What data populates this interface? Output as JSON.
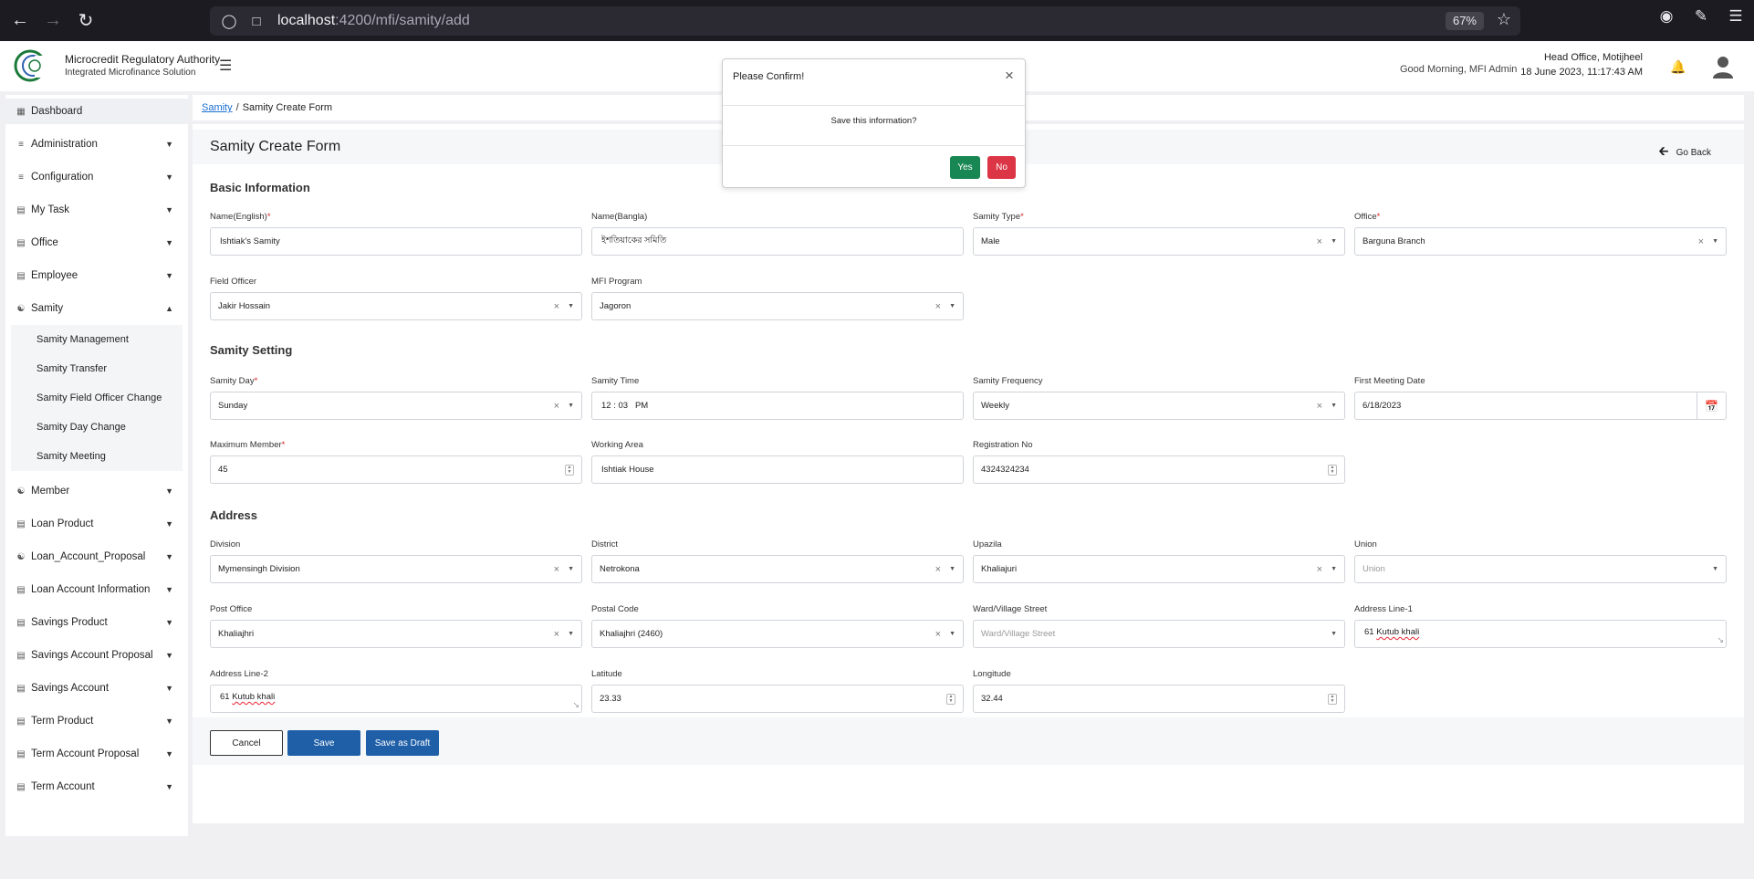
{
  "browser": {
    "url_host": "localhost",
    "url_path": ":4200/mfi/samity/add",
    "zoom": "67%"
  },
  "header": {
    "brand_title": "Microcredit Regulatory Authority",
    "brand_subtitle": "Integrated Microfinance Solution",
    "greeting": "Good Morning, MFI Admin",
    "office": "Head Office, Motijheel",
    "datetime": "18 June 2023, 11:17:43 AM"
  },
  "sidebar": {
    "dashboard": "Dashboard",
    "items": [
      {
        "label": "Administration",
        "icon": "sliders-icon"
      },
      {
        "label": "Configuration",
        "icon": "sliders-icon"
      },
      {
        "label": "My Task",
        "icon": "task-icon"
      },
      {
        "label": "Office",
        "icon": "office-icon"
      },
      {
        "label": "Employee",
        "icon": "employee-icon"
      },
      {
        "label": "Samity",
        "icon": "group-icon"
      }
    ],
    "samity_sub": [
      "Samity Management",
      "Samity Transfer",
      "Samity Field Officer Change",
      "Samity Day Change",
      "Samity Meeting"
    ],
    "items_after": [
      {
        "label": "Member",
        "icon": "group-icon"
      },
      {
        "label": "Loan Product",
        "icon": "product-icon"
      },
      {
        "label": "Loan_Account_Proposal",
        "icon": "group-icon"
      },
      {
        "label": "Loan Account Information",
        "icon": "product-icon"
      },
      {
        "label": "Savings Product",
        "icon": "product-icon"
      },
      {
        "label": "Savings Account Proposal",
        "icon": "product-icon"
      },
      {
        "label": "Savings Account",
        "icon": "product-icon"
      },
      {
        "label": "Term Product",
        "icon": "product-icon"
      },
      {
        "label": "Term Account Proposal",
        "icon": "product-icon"
      },
      {
        "label": "Term Account",
        "icon": "product-icon"
      }
    ]
  },
  "breadcrumb": {
    "link": "Samity",
    "separator": "/",
    "current": "Samity Create Form"
  },
  "form": {
    "title": "Samity Create Form",
    "go_back": "Go Back",
    "sections": {
      "basic": "Basic Information",
      "setting": "Samity Setting",
      "address": "Address"
    },
    "name_en": {
      "label": "Name(English)",
      "value": "Ishtiak's Samity"
    },
    "name_bn": {
      "label": "Name(Bangla)",
      "value": "ইশতিয়াকের সমিতি"
    },
    "samity_type": {
      "label": "Samity Type",
      "value": "Male"
    },
    "office": {
      "label": "Office",
      "value": "Barguna Branch"
    },
    "field_officer": {
      "label": "Field Officer",
      "value": "Jakir Hossain"
    },
    "mfi_program": {
      "label": "MFI Program",
      "value": "Jagoron"
    },
    "samity_day": {
      "label": "Samity Day",
      "value": "Sunday"
    },
    "samity_time": {
      "label": "Samity Time",
      "value": "12 : 03   PM"
    },
    "samity_frequency": {
      "label": "Samity Frequency",
      "value": "Weekly"
    },
    "first_meeting_date": {
      "label": "First Meeting Date",
      "value": "6/18/2023"
    },
    "max_member": {
      "label": "Maximum Member",
      "value": "45"
    },
    "working_area": {
      "label": "Working Area",
      "value": "Ishtiak House"
    },
    "registration_no": {
      "label": "Registration No",
      "value": "4324324234"
    },
    "division": {
      "label": "Division",
      "value": "Mymensingh Division"
    },
    "district": {
      "label": "District",
      "value": "Netrokona"
    },
    "upazila": {
      "label": "Upazila",
      "value": "Khaliajuri"
    },
    "union": {
      "label": "Union",
      "placeholder": "Union"
    },
    "post_office": {
      "label": "Post Office",
      "value": "Khaliajhri"
    },
    "postal_code": {
      "label": "Postal Code",
      "value": "Khaliajhri (2460)"
    },
    "ward": {
      "label": "Ward/Village Street",
      "placeholder": "Ward/Village Street"
    },
    "address1": {
      "label": "Address Line-1",
      "num": "61",
      "words": "Kutub khali"
    },
    "address2": {
      "label": "Address Line-2",
      "num": "61",
      "words": "Kutub khali"
    },
    "latitude": {
      "label": "Latitude",
      "value": "23.33"
    },
    "longitude": {
      "label": "Longitude",
      "value": "32.44"
    },
    "buttons": {
      "cancel": "Cancel",
      "save": "Save",
      "draft": "Save as Draft"
    }
  },
  "modal": {
    "title": "Please Confirm!",
    "message": "Save this information?",
    "yes": "Yes",
    "no": "No"
  },
  "colors": {
    "primary": "#1f5fa8",
    "success": "#198754",
    "danger": "#dc3545",
    "link": "#1a6fd1"
  }
}
